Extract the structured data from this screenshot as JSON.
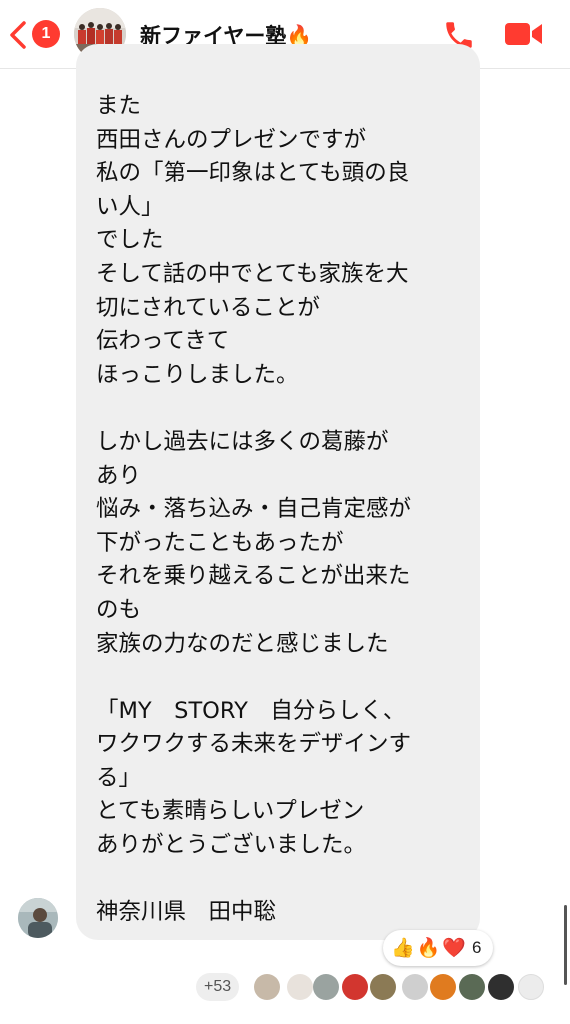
{
  "header": {
    "back_badge": "1",
    "title": "新ファイヤー塾🔥",
    "icons": [
      "back-chevron-icon",
      "phone-icon",
      "video-camera-icon"
    ],
    "accent_color": "#ff3b30",
    "online_color": "#31a24c"
  },
  "message": {
    "paragraphs": [
      "また\n西田さんのプレゼンですが\n私の「第一印象はとても頭の良\nい人」\nでした\nそして話の中でとても家族を大\n切にされていることが\n伝わってきて\nほっこりしました。",
      "しかし過去には多くの葛藤が\nあり\n悩み・落ち込み・自己肯定感が\n下がったこともあったが\nそれを乗り越えることが出来た\nのも\n家族の力なのだと感じました",
      "「MY　STORY　自分らしく、\nワクワクする未来をデザインす\nる」\nとても素晴らしいプレゼン\nありがとうございました。",
      "神奈川県　田中聡"
    ],
    "bubble_color": "#efefef"
  },
  "reactions": {
    "emojis": [
      "👍",
      "🔥",
      "❤️"
    ],
    "count": "6"
  },
  "read_receipts": {
    "more_count": "+53",
    "avatar_colors": [
      "#c7b9a8",
      "#e8e2dc",
      "#9aa3a0",
      "#d2362f",
      "#8b7a55",
      "#cfcfcf",
      "#e07b1f",
      "#5a6a55",
      "#2f2f2f",
      "#ececec"
    ]
  }
}
